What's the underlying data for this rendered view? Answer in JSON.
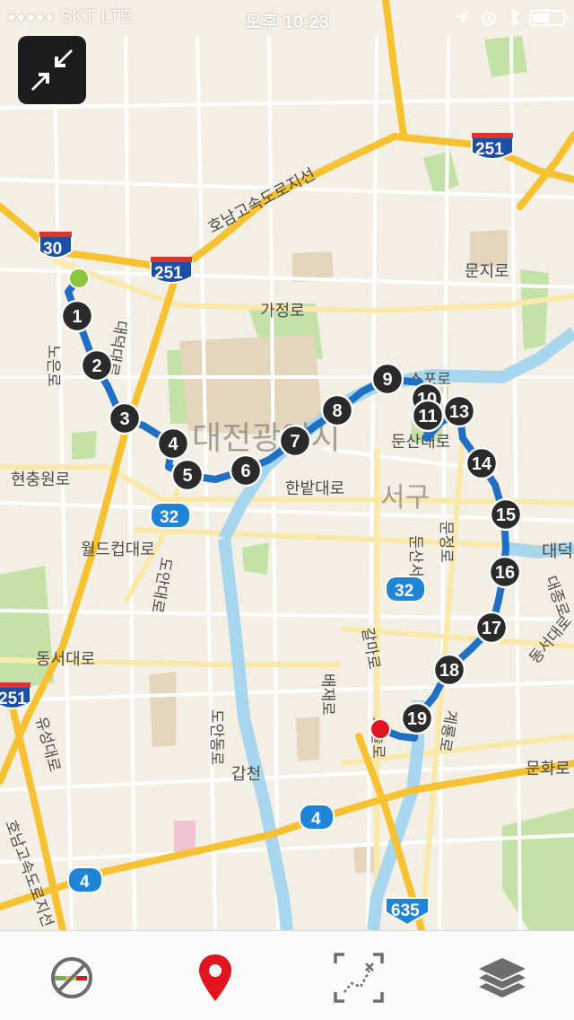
{
  "status_bar": {
    "signal": "●●●●●",
    "carrier": "SKT",
    "network": "LTE",
    "time": "오후 10:23"
  },
  "map": {
    "district_labels": {
      "city": "대전광역시",
      "district": "서구"
    },
    "road_labels": {
      "expressway_branch": "호남고속도로지선",
      "gajeong": "가정로",
      "munji": "문지로",
      "hyeonchung": "현충원로",
      "hanbat": "한밭대로",
      "worldcup": "월드컵대로",
      "dongseo": "동서대로",
      "dunsan": "둔산대로",
      "gapcheon": "갑천",
      "munhwa": "문화로",
      "gyeryong": "계룡로",
      "dosol": "도솔로",
      "doan": "도안대로",
      "doandong": "도안동로",
      "yuseong": "유성대로",
      "baejae": "배재로",
      "galma": "갈마로",
      "daejong": "대종로",
      "dongseo2": "동서대로",
      "munjeong": "문정로",
      "dunsanseo": "둔산서로",
      "honam2": "호남고속도로지선",
      "daedeok": "대덕대로",
      "nogeum": "노은로",
      "dae": "대덕",
      "spo": "스포로"
    },
    "shields": [
      {
        "label": "30",
        "kind": "interstate"
      },
      {
        "label": "251",
        "kind": "interstate"
      },
      {
        "label": "251",
        "kind": "interstate"
      },
      {
        "label": "251",
        "kind": "interstate"
      },
      {
        "label": "32",
        "kind": "national"
      },
      {
        "label": "32",
        "kind": "national"
      },
      {
        "label": "4",
        "kind": "national"
      },
      {
        "label": "4",
        "kind": "national"
      },
      {
        "label": "635",
        "kind": "local"
      }
    ],
    "waypoints": [
      "1",
      "2",
      "3",
      "4",
      "5",
      "6",
      "7",
      "8",
      "9",
      "10",
      "11",
      "13",
      "14",
      "15",
      "16",
      "17",
      "18",
      "19"
    ],
    "colors": {
      "route": "#1f6fc4",
      "start": "#8cc63f",
      "end": "#e0151f",
      "major_road": "#f7c232",
      "river": "#a9d6ef",
      "park": "#c4e2a8"
    }
  },
  "toolbar": {
    "icons": [
      "gps-off-icon",
      "pin-icon",
      "route-select-icon",
      "layers-icon"
    ],
    "pin_color": "#e0151f"
  }
}
